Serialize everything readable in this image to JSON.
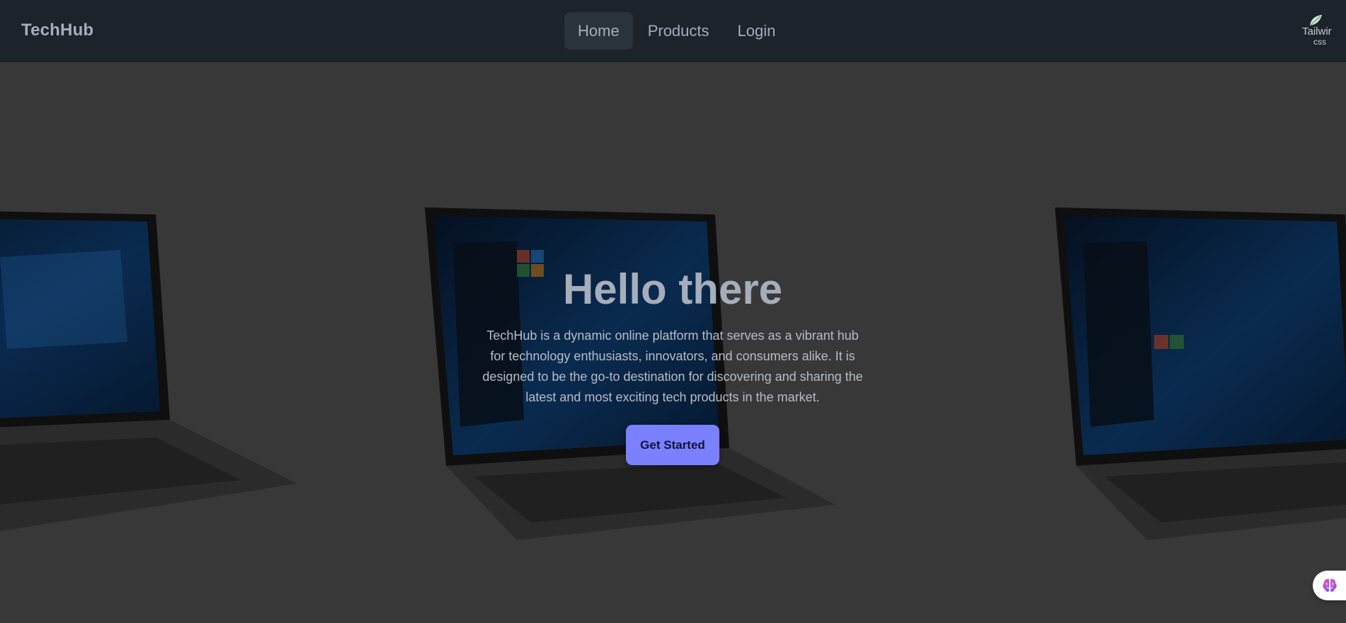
{
  "navbar": {
    "brand": "TechHub",
    "items": [
      {
        "label": "Home",
        "active": true
      },
      {
        "label": "Products",
        "active": false
      },
      {
        "label": "Login",
        "active": false
      }
    ],
    "logo": {
      "text_line1": "Tailwir",
      "text_line2": "css",
      "icon": "tailwind-leaf-icon"
    }
  },
  "hero": {
    "title": "Hello there",
    "description": "TechHub is a dynamic online platform that serves as a vibrant hub for technology enthusiasts, innovators, and consumers alike. It is designed to be the go-to destination for discovering and sharing the latest and most exciting tech products in the market.",
    "cta_label": "Get Started",
    "background_icon": "laptop-icon"
  },
  "floating_widget": {
    "icon": "brain-icon"
  },
  "colors": {
    "navbar_bg": "#1d232a",
    "nav_active_bg": "#2a323c",
    "text": "#a6adbb",
    "hero_bg": "#4b4b4b",
    "cta_bg": "#7b80ff",
    "cta_text": "#10133a"
  }
}
